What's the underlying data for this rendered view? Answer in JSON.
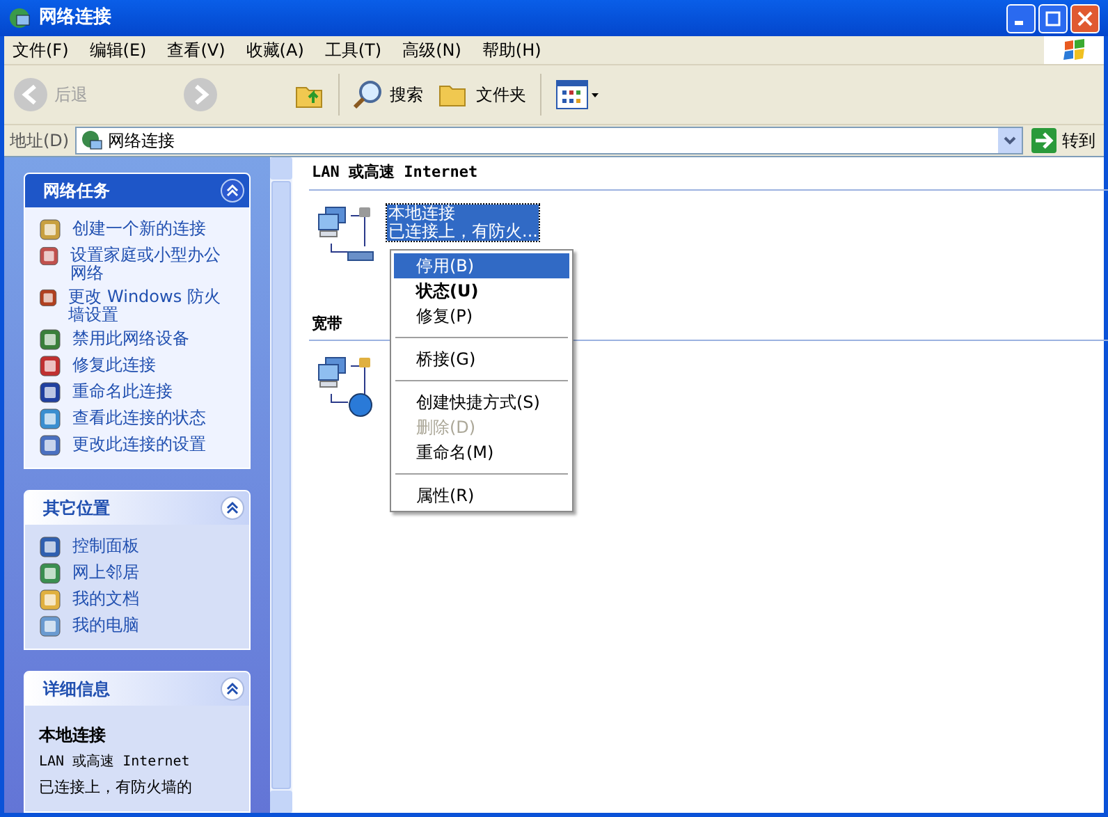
{
  "window": {
    "title": "网络连接"
  },
  "menu_bar": [
    "文件(F)",
    "编辑(E)",
    "查看(V)",
    "收藏(A)",
    "工具(T)",
    "高级(N)",
    "帮助(H)"
  ],
  "toolbar": {
    "back": "后退",
    "search": "搜索",
    "folders": "文件夹"
  },
  "address_bar": {
    "label": "地址(D)",
    "value": "网络连接",
    "go": "转到"
  },
  "sidebar": {
    "panels": [
      {
        "title": "网络任务",
        "kind": "primary",
        "items": [
          "创建一个新的连接",
          "设置家庭或小型办公网络",
          "更改 Windows 防火墙设置",
          "禁用此网络设备",
          "修复此连接",
          "重命名此连接",
          "查看此连接的状态",
          "更改此连接的设置"
        ]
      },
      {
        "title": "其它位置",
        "kind": "normal",
        "items": [
          "控制面板",
          "网上邻居",
          "我的文档",
          "我的电脑"
        ]
      },
      {
        "title": "详细信息",
        "kind": "details",
        "details": {
          "name": "本地连接",
          "type": "LAN 或高速 Internet",
          "status": "已连接上，有防火墙的"
        }
      }
    ]
  },
  "content": {
    "groups": [
      {
        "title": "LAN 或高速 Internet",
        "connections": [
          {
            "kind": "lan",
            "selected": true,
            "lines": [
              "本地连接",
              "已连接上，有防火..."
            ]
          }
        ]
      },
      {
        "title": "宽带",
        "connections": [
          {
            "kind": "broadband"
          }
        ]
      }
    ]
  },
  "context_menu": [
    {
      "kind": "item",
      "label": "停用(B)",
      "selected": true,
      "bold": false,
      "disabled": false
    },
    {
      "kind": "item",
      "label": "状态(U)",
      "selected": false,
      "bold": true,
      "disabled": false
    },
    {
      "kind": "item",
      "label": "修复(P)",
      "selected": false,
      "bold": false,
      "disabled": false
    },
    {
      "kind": "separator"
    },
    {
      "kind": "item",
      "label": "桥接(G)",
      "selected": false,
      "bold": false,
      "disabled": false
    },
    {
      "kind": "separator"
    },
    {
      "kind": "item",
      "label": "创建快捷方式(S)",
      "selected": false,
      "bold": false,
      "disabled": false
    },
    {
      "kind": "item",
      "label": "删除(D)",
      "selected": false,
      "bold": false,
      "disabled": true
    },
    {
      "kind": "item",
      "label": "重命名(M)",
      "selected": false,
      "bold": false,
      "disabled": false
    },
    {
      "kind": "separator"
    },
    {
      "kind": "item",
      "label": "属性(R)",
      "selected": false,
      "bold": false,
      "disabled": false
    }
  ]
}
